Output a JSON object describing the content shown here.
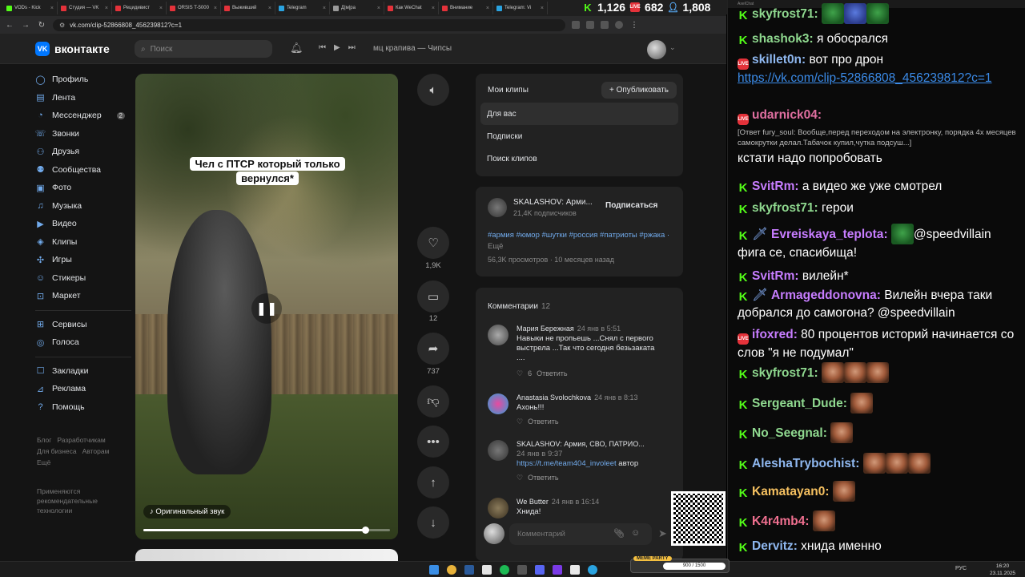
{
  "browser": {
    "tabs": [
      {
        "label": "VODs - Kick",
        "color": "#53fc18"
      },
      {
        "label": "Студия — VK",
        "color": "#e4323a"
      },
      {
        "label": "Рецидивист",
        "color": "#e4323a"
      },
      {
        "label": "ORSIS T-5000",
        "color": "#e4323a"
      },
      {
        "label": "Выживший",
        "color": "#e4323a"
      },
      {
        "label": "Telegram",
        "color": "#2aa3e0"
      },
      {
        "label": "Д|м|ра",
        "color": "#999999"
      },
      {
        "label": "Как WeChat",
        "color": "#e4323a"
      },
      {
        "label": "Внимание",
        "color": "#e4323a"
      },
      {
        "label": "Telegram: Vi",
        "color": "#2aa3e0"
      }
    ],
    "url": "vk.com/clip-52866808_456239812?c=1"
  },
  "stream_counters": {
    "kick": "1,126",
    "vk": "682",
    "total": "1,808"
  },
  "vk": {
    "logo_text": "вконтакте",
    "search_placeholder": "Поиск",
    "now_playing": "мц крапива — Чипсы",
    "menu": [
      {
        "label": "Профиль",
        "icon": "profile-icon",
        "glyph": "◯"
      },
      {
        "label": "Лента",
        "icon": "feed-icon",
        "glyph": "▤"
      },
      {
        "label": "Мессенджер",
        "icon": "messenger-icon",
        "glyph": "◔",
        "badge": "2"
      },
      {
        "label": "Звонки",
        "icon": "calls-icon",
        "glyph": "☏"
      },
      {
        "label": "Друзья",
        "icon": "friends-icon",
        "glyph": "⚇"
      },
      {
        "label": "Сообщества",
        "icon": "communities-icon",
        "glyph": "⚉"
      },
      {
        "label": "Фото",
        "icon": "photo-icon",
        "glyph": "▣"
      },
      {
        "label": "Музыка",
        "icon": "music-icon",
        "glyph": "♫"
      },
      {
        "label": "Видео",
        "icon": "video-icon",
        "glyph": "▶"
      },
      {
        "label": "Клипы",
        "icon": "clips-icon",
        "glyph": "◈"
      },
      {
        "label": "Игры",
        "icon": "games-icon",
        "glyph": "✣"
      },
      {
        "label": "Стикеры",
        "icon": "stickers-icon",
        "glyph": "☺"
      },
      {
        "label": "Маркет",
        "icon": "market-icon",
        "glyph": "⊡"
      }
    ],
    "menu2": [
      {
        "label": "Сервисы",
        "icon": "services-icon",
        "glyph": "⊞"
      },
      {
        "label": "Голоса",
        "icon": "votes-icon",
        "glyph": "◎"
      }
    ],
    "menu3": [
      {
        "label": "Закладки",
        "icon": "bookmarks-icon",
        "glyph": "☐"
      },
      {
        "label": "Реклама",
        "icon": "ads-icon",
        "glyph": "⊿"
      },
      {
        "label": "Помощь",
        "icon": "help-icon",
        "glyph": "?"
      }
    ],
    "footer_links": [
      "Блог",
      "Разработчикам",
      "Для бизнеса",
      "Авторам",
      "Ещё"
    ],
    "tech_note": "Применяются рекомендательные технологии",
    "video": {
      "caption_line1": "Чел с ПТСР который только",
      "caption_line2": "вернулся*",
      "sound": "Оригинальный звук",
      "progress": 0.9
    },
    "actions": {
      "likes": "1,9K",
      "comments": "12",
      "shares": "737"
    },
    "clips_panel": {
      "my_clips": "Мои клипы",
      "publish": "Опубликовать",
      "for_you": "Для вас",
      "subscriptions": "Подписки",
      "search": "Поиск клипов"
    },
    "author": {
      "name": "SKALASHOV: Арми...",
      "subs": "21,4K подписчиков",
      "subscribe": "Подписаться",
      "tags": "#армия #юмор #шутки #россия #патриоты #ржака",
      "more": "Ещё",
      "views": "56,3K просмотров · 10 месяцев назад"
    },
    "comments_title": "Комментарии",
    "comments_count": "12",
    "comments": [
      {
        "author": "Мария Бережная",
        "date": "24 янв в 5:51",
        "text": "Навыки не пропьешь ...Снял с первого выстрела ...Так что сегодня безьзаката ....",
        "likes": "6",
        "reply": "Ответить"
      },
      {
        "author": "Anastasia Svolochkova",
        "date": "24 янв в 8:13",
        "text": "Ахонь!!!",
        "reply": "Ответить"
      },
      {
        "author": "SKALASHOV: Армия, СВО, ПАТРИО...",
        "date": "24 янв в 9:37",
        "link": "https://t.me/team404_involeet",
        "text": "автор",
        "reply": "Ответить"
      },
      {
        "author": "We Butter",
        "date": "24 янв в 16:14",
        "text": "Хнида!"
      }
    ],
    "comment_placeholder": "Комментарий"
  },
  "chat": {
    "title": "AxelChat",
    "messages": [
      {
        "platform": "kick",
        "user": "skyfrost71",
        "color": "#8fd88f",
        "text": "",
        "emotes": [
          "green",
          "blue",
          "green"
        ]
      },
      {
        "platform": "kick",
        "user": "shashok3",
        "color": "#8fd88f",
        "text": "я обосрался"
      },
      {
        "platform": "vk",
        "user": "skillet0n",
        "color": "#8fb8f0",
        "text": "вот про дрон",
        "link": "https://vk.com/clip-52866808_456239812?c=1"
      },
      {
        "platform": "vk",
        "user": "udarnick04",
        "color": "#e06fa0",
        "reply": "[Ответ fury_soul: Вообще,перед переходом на электронку, порядка 4х месяцев самокрутки делал.Табачок купил,чутка подсуш...]",
        "text": "кстати надо попробовать"
      },
      {
        "platform": "kick",
        "user": "SvitRm",
        "color": "#c77dff",
        "text": "а видео же уже смотрел"
      },
      {
        "platform": "kick",
        "user": "skyfrost71",
        "color": "#8fd88f",
        "text": "герои"
      },
      {
        "platform": "kick",
        "user": "Evreiskaya_teplota",
        "color": "#c77dff",
        "text": "@speedvillain фига се, спасибища!"
      },
      {
        "platform": "kick",
        "user": "SvitRm",
        "color": "#c77dff",
        "text": "вилейн*"
      },
      {
        "platform": "kick",
        "user": "Armageddonovna",
        "color": "#c77dff",
        "text": "Вилейн вчера таки добрался до самогона? @speedvillain"
      },
      {
        "platform": "vk",
        "user": "ifoxred",
        "color": "#c77dff",
        "text": "80 процентов историй начинается со слов \"я не подумал\""
      },
      {
        "platform": "kick",
        "user": "skyfrost71",
        "color": "#8fd88f",
        "text": ""
      },
      {
        "platform": "kick",
        "user": "Sergeant_Dude",
        "color": "#8fd88f",
        "text": ""
      },
      {
        "platform": "kick",
        "user": "No_Seegnal",
        "color": "#8fd88f",
        "text": ""
      },
      {
        "platform": "kick",
        "user": "AleshaTrybochist",
        "color": "#8fb8f0",
        "text": ""
      },
      {
        "platform": "kick",
        "user": "Kamatayan0",
        "color": "#f5c060",
        "text": ""
      },
      {
        "platform": "kick",
        "user": "K4r4mb4",
        "color": "#f07090",
        "text": ""
      },
      {
        "platform": "kick",
        "user": "Dervitz",
        "color": "#8fb8f0",
        "text": "хнида именно"
      }
    ]
  },
  "taskbar": {
    "lang": "РУС",
    "time": "16:20",
    "date": "23.11.2025",
    "meme_label": "MEME PARTY",
    "meme_progress": "900 / 1500"
  }
}
